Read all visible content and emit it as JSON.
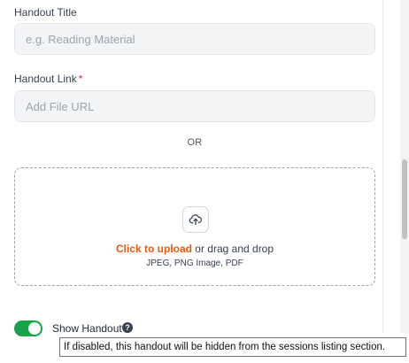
{
  "form": {
    "title_label": "Handout Title",
    "title_placeholder": "e.g. Reading Material",
    "link_label": "Handout Link",
    "required_mark": "*",
    "link_placeholder": "Add File URL",
    "or_text": "OR"
  },
  "dropzone": {
    "icon": "upload-cloud-icon",
    "click_text": "Click to upload",
    "drag_text": " or drag and drop",
    "formats": "JPEG, PNG Image, PDF"
  },
  "toggle": {
    "label": "Show Handout",
    "enabled": true,
    "help_glyph": "?"
  },
  "tooltip": {
    "text": "If disabled, this handout will be hidden from the sessions listing section."
  },
  "colors": {
    "accent_orange": "#ea580c",
    "toggle_on": "#16a34a",
    "required": "#e11d48"
  }
}
